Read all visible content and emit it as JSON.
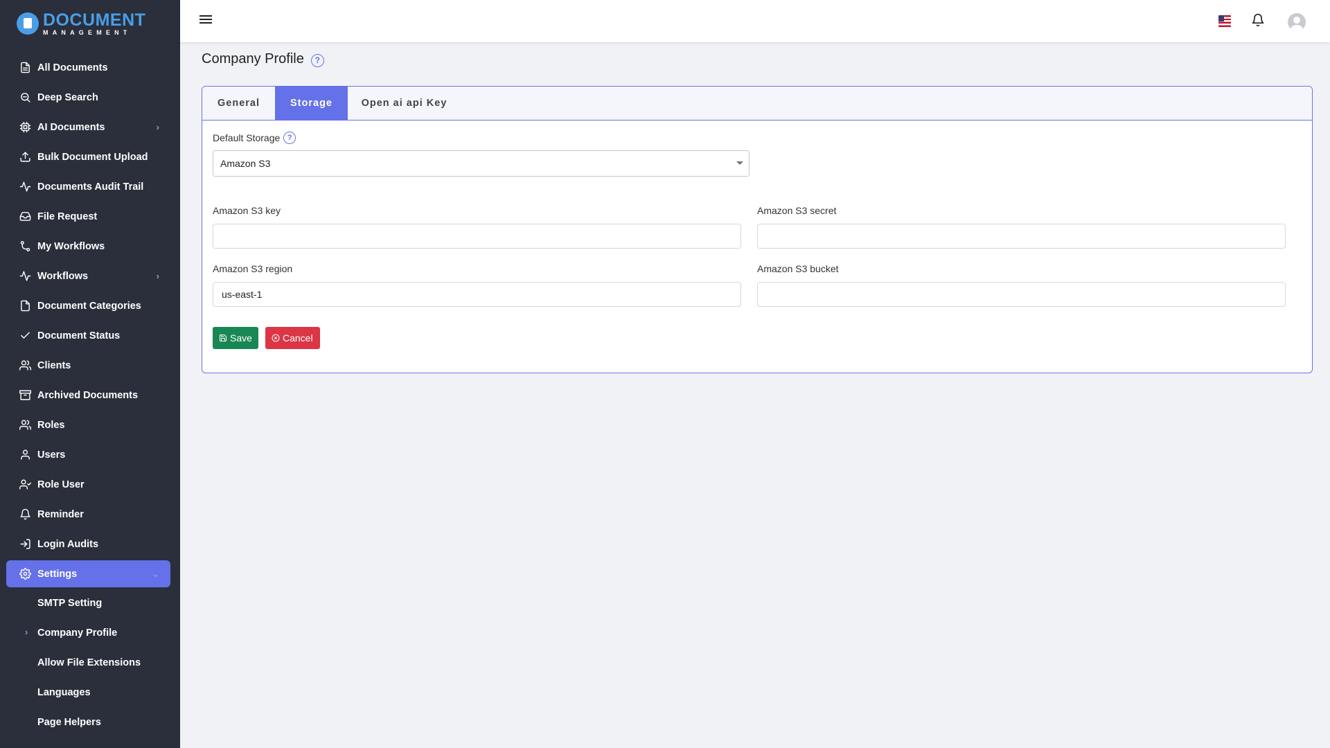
{
  "app": {
    "logo_main": "DOCUMENT",
    "logo_sub": "MANAGEMENT"
  },
  "sidebar": {
    "items": [
      {
        "label": "All Documents",
        "icon": "file-text-icon"
      },
      {
        "label": "Deep Search",
        "icon": "search-icon"
      },
      {
        "label": "AI Documents",
        "icon": "cpu-icon",
        "has_children": true
      },
      {
        "label": "Bulk Document Upload",
        "icon": "upload-icon"
      },
      {
        "label": "Documents Audit Trail",
        "icon": "activity-icon"
      },
      {
        "label": "File Request",
        "icon": "inbox-icon"
      },
      {
        "label": "My Workflows",
        "icon": "git-branch-icon"
      },
      {
        "label": "Workflows",
        "icon": "activity-icon",
        "has_children": true
      },
      {
        "label": "Document Categories",
        "icon": "file-icon"
      },
      {
        "label": "Document Status",
        "icon": "check-icon"
      },
      {
        "label": "Clients",
        "icon": "users-icon"
      },
      {
        "label": "Archived Documents",
        "icon": "archive-icon"
      },
      {
        "label": "Roles",
        "icon": "users-icon"
      },
      {
        "label": "Users",
        "icon": "user-icon"
      },
      {
        "label": "Role User",
        "icon": "user-check-icon"
      },
      {
        "label": "Reminder",
        "icon": "bell-icon"
      },
      {
        "label": "Login Audits",
        "icon": "log-in-icon"
      },
      {
        "label": "Settings",
        "icon": "settings-icon",
        "active": true
      }
    ],
    "settings_children": [
      {
        "label": "SMTP Setting"
      },
      {
        "label": "Company Profile",
        "current": true
      },
      {
        "label": "Allow File Extensions"
      },
      {
        "label": "Languages"
      },
      {
        "label": "Page Helpers"
      }
    ]
  },
  "header": {
    "language_flag": "us-flag-icon",
    "notification_icon": "bell-icon",
    "avatar_icon": "user-avatar-icon"
  },
  "page": {
    "title": "Company Profile",
    "help_glyph": "?",
    "tabs": [
      {
        "label": "General",
        "active": false
      },
      {
        "label": "Storage",
        "active": true
      },
      {
        "label": "Open ai api Key",
        "active": false
      }
    ]
  },
  "storage_form": {
    "default_storage_label": "Default Storage",
    "default_storage_value": "Amazon S3",
    "s3_key_label": "Amazon S3 key",
    "s3_key_value": "",
    "s3_secret_label": "Amazon S3 secret",
    "s3_secret_value": "",
    "s3_region_label": "Amazon S3 region",
    "s3_region_value": "us-east-1",
    "s3_bucket_label": "Amazon S3 bucket",
    "s3_bucket_value": "",
    "save_label": "Save",
    "cancel_label": "Cancel"
  },
  "colors": {
    "sidebar_bg": "#2a2f3b",
    "accent": "#6571e8",
    "save": "#198754",
    "cancel": "#dc3545"
  }
}
